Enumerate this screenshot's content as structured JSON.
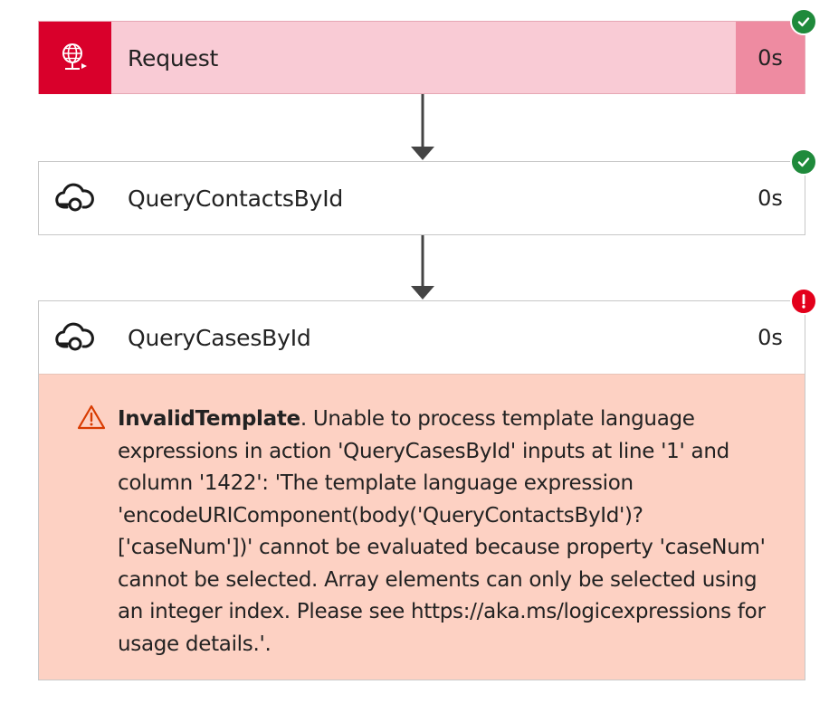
{
  "steps": [
    {
      "title": "Request",
      "duration": "0s",
      "status": "success",
      "icon": "globe-request-icon"
    },
    {
      "title": "QueryContactsById",
      "duration": "0s",
      "status": "success",
      "icon": "cloud-connector-icon"
    },
    {
      "title": "QueryCasesById",
      "duration": "0s",
      "status": "error",
      "icon": "cloud-connector-icon",
      "error": {
        "code": "InvalidTemplate",
        "message": ". Unable to process template language expressions in action 'QueryCasesById' inputs at line '1' and column '1422': 'The template language expression 'encodeURIComponent(body('QueryContactsById')?['caseNum'])' cannot be evaluated because property 'caseNum' cannot be selected. Array elements can only be selected using an integer index. Please see https://aka.ms/logicexpressions for usage details.'."
      }
    }
  ],
  "colors": {
    "request_icon_bg": "#d9002b",
    "request_bg": "#f9cbd5",
    "request_duration_bg": "#ee8ba1",
    "success": "#1f8a3b",
    "error": "#e3001b",
    "error_panel_bg": "#fdd1c3",
    "warning": "#d83b01"
  }
}
